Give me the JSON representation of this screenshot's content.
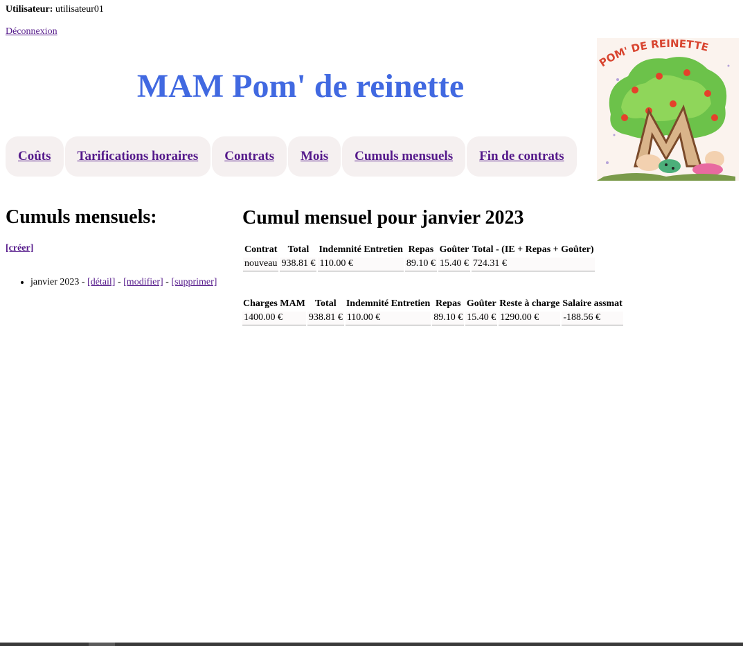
{
  "user": {
    "label": "Utilisateur:",
    "name": "utilisateur01"
  },
  "logout_label": "Déconnexion",
  "site_title": "MAM Pom' de reinette",
  "logo": {
    "text": "POM' DE REINETTE",
    "letters": "MAM"
  },
  "nav": [
    {
      "label": "Coûts"
    },
    {
      "label": "Tarifications horaires"
    },
    {
      "label": "Contrats"
    },
    {
      "label": "Mois"
    },
    {
      "label": "Cumuls mensuels"
    },
    {
      "label": "Fin de contrats"
    }
  ],
  "sidebar": {
    "title": "Cumuls mensuels:",
    "create_label": "[créer]",
    "items": [
      {
        "label": "janvier 2023",
        "sep": " - ",
        "detail": "[détail]",
        "modify": "[modifier]",
        "delete": "[supprimer]"
      }
    ]
  },
  "main": {
    "title": "Cumul mensuel pour janvier 2023",
    "table1": {
      "headers": [
        "Contrat",
        "Total",
        "Indemnité Entretien",
        "Repas",
        "Goûter",
        "Total - (IE + Repas + Goûter)"
      ],
      "rows": [
        [
          "nouveau",
          "938.81 €",
          "110.00 €",
          "89.10 €",
          "15.40 €",
          "724.31 €"
        ]
      ]
    },
    "table2": {
      "headers": [
        "Charges MAM",
        "Total",
        "Indemnité Entretien",
        "Repas",
        "Goûter",
        "Reste à charge",
        "Salaire assmat"
      ],
      "rows": [
        [
          "1400.00 €",
          "938.81 €",
          "110.00 €",
          "89.10 €",
          "15.40 €",
          "1290.00 €",
          "-188.56 €"
        ]
      ]
    }
  },
  "colors": {
    "title": "#4169e1",
    "link": "#551a8b",
    "nav_bg": "#f5f0f0"
  }
}
